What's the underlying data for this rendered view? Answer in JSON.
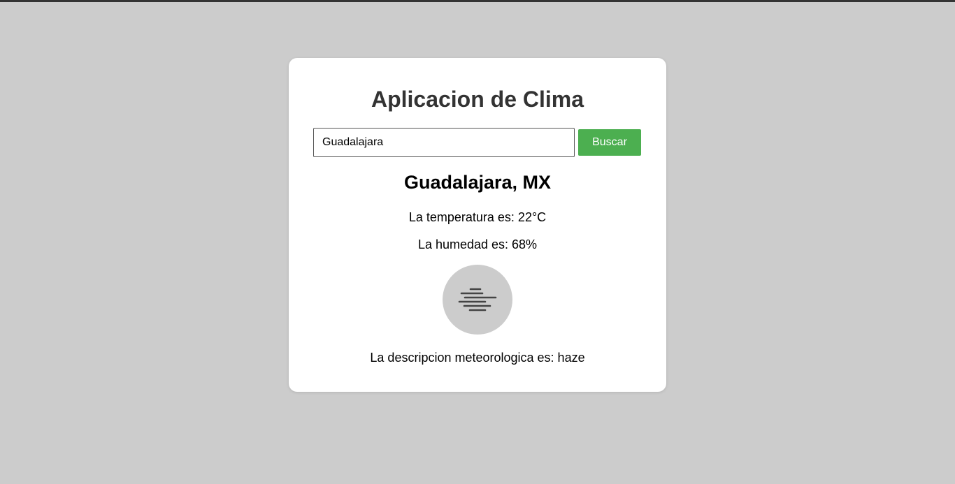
{
  "app": {
    "title": "Aplicacion de Clima"
  },
  "search": {
    "value": "Guadalajara",
    "button_label": "Buscar"
  },
  "weather": {
    "location": "Guadalajara, MX",
    "temperature_text": "La temperatura es: 22°C",
    "humidity_text": "La humedad es: 68%",
    "description_text": "La descripcion meteorologica es: haze",
    "icon": "haze-icon"
  },
  "colors": {
    "background": "#cccccc",
    "card": "#ffffff",
    "button": "#4caf50",
    "title": "#333333"
  }
}
